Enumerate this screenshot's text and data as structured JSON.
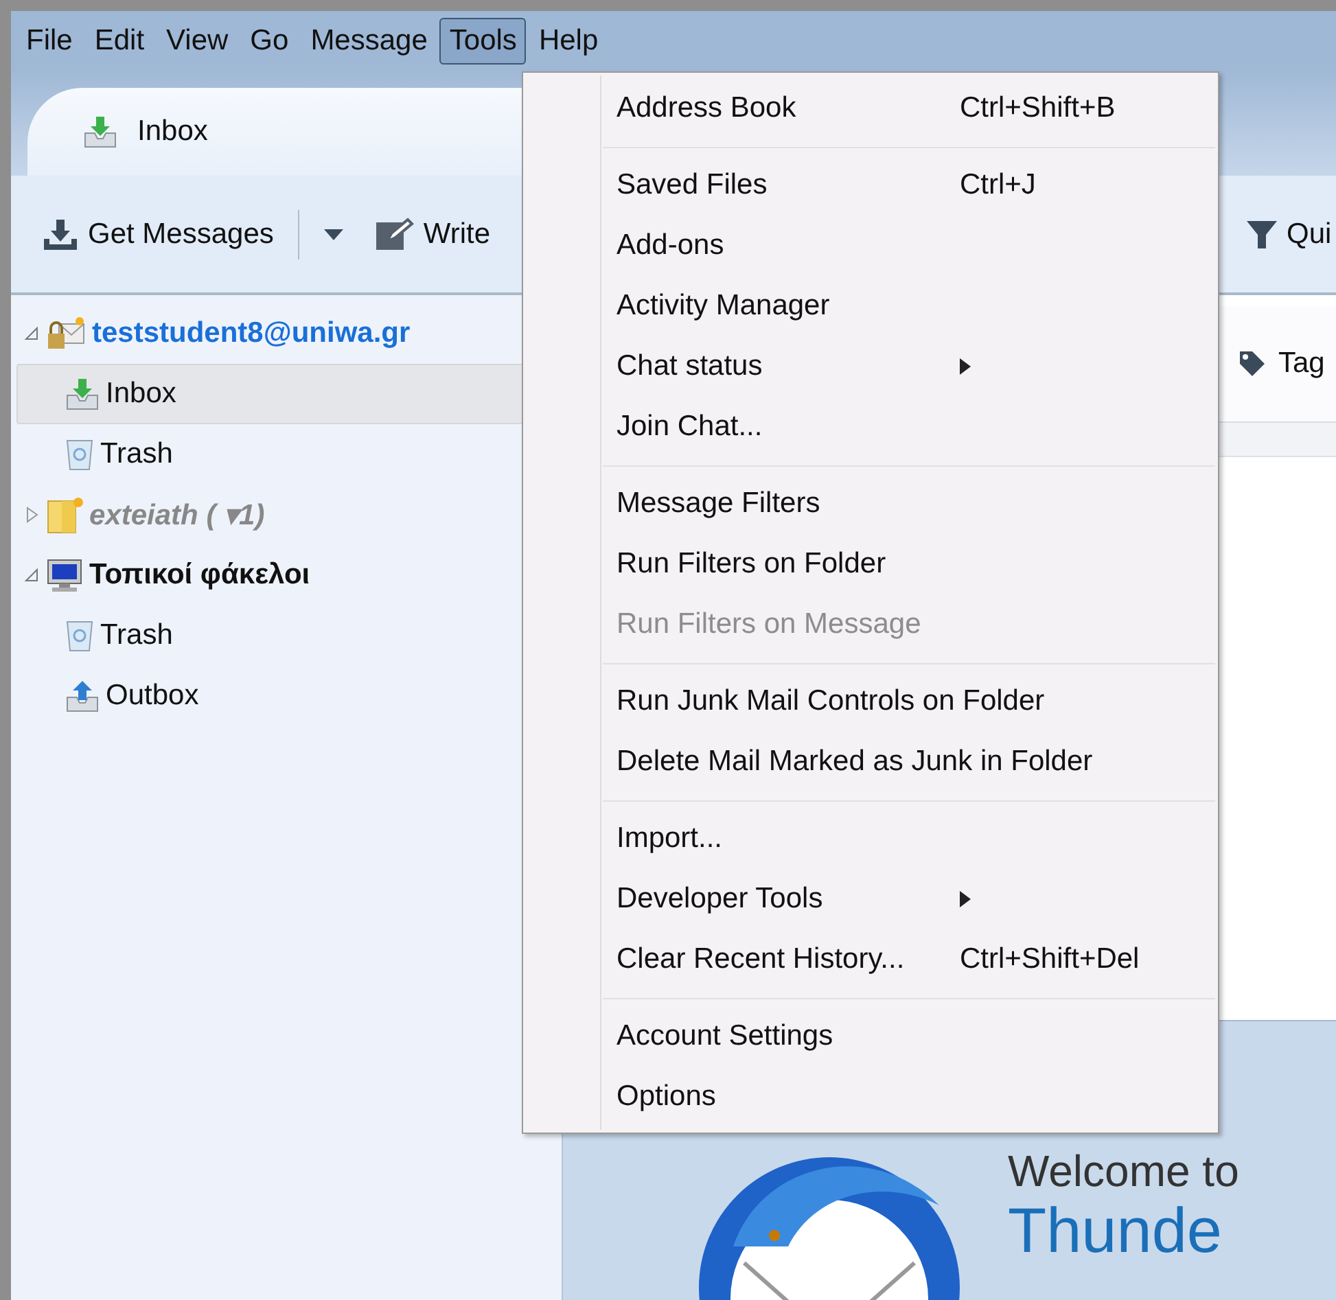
{
  "menu_bar": [
    {
      "label": "File",
      "selected": false
    },
    {
      "label": "Edit",
      "selected": false
    },
    {
      "label": "View",
      "selected": false
    },
    {
      "label": "Go",
      "selected": false
    },
    {
      "label": "Message",
      "selected": false
    },
    {
      "label": "Tools",
      "selected": true
    },
    {
      "label": "Help",
      "selected": false
    }
  ],
  "tabs": [
    {
      "label": "Inbox",
      "selected": true
    }
  ],
  "toolbar": [
    {
      "kind": "get",
      "label": "Get Messages"
    },
    {
      "kind": "write",
      "label": "Write"
    },
    {
      "kind": "filter",
      "label": "Qui"
    }
  ],
  "folder_tree": [
    {
      "label": "teststudent8@uniwa.gr",
      "kind": "account",
      "expanded": true,
      "selected": false,
      "disabled": false,
      "children": [
        {
          "label": "Inbox",
          "kind": "inbox",
          "selected": true
        },
        {
          "label": "Trash",
          "kind": "trash",
          "selected": false
        }
      ]
    },
    {
      "label": "exteiath ( ▾1)",
      "kind": "news",
      "expanded": false,
      "selected": false,
      "disabled": true
    },
    {
      "label": "Τοπικοί φάκελοι",
      "kind": "local",
      "expanded": true,
      "selected": false,
      "disabled": false,
      "children": [
        {
          "label": "Trash",
          "kind": "trash",
          "selected": false
        },
        {
          "label": "Outbox",
          "kind": "outbox",
          "selected": false
        }
      ]
    }
  ],
  "message_pane": {
    "tag_button": "Tag"
  },
  "welcome": {
    "heading": "Welcome to",
    "title": "Thunde"
  },
  "tools_menu": [
    {
      "kind": "item",
      "label": "Address Book",
      "shortcut": "Ctrl+Shift+B",
      "disabled": false,
      "submenu": false
    },
    {
      "kind": "separator"
    },
    {
      "kind": "item",
      "label": "Saved Files",
      "shortcut": "Ctrl+J",
      "disabled": false,
      "submenu": false
    },
    {
      "kind": "item",
      "label": "Add-ons",
      "disabled": false,
      "submenu": false
    },
    {
      "kind": "item",
      "label": "Activity Manager",
      "disabled": false,
      "submenu": false
    },
    {
      "kind": "item",
      "label": "Chat status",
      "disabled": false,
      "submenu": true
    },
    {
      "kind": "item",
      "label": "Join Chat...",
      "disabled": false,
      "submenu": false
    },
    {
      "kind": "separator"
    },
    {
      "kind": "item",
      "label": "Message Filters",
      "disabled": false,
      "submenu": false
    },
    {
      "kind": "item",
      "label": "Run Filters on Folder",
      "disabled": false,
      "submenu": false
    },
    {
      "kind": "item",
      "label": "Run Filters on Message",
      "disabled": true,
      "submenu": false
    },
    {
      "kind": "separator"
    },
    {
      "kind": "item",
      "label": "Run Junk Mail Controls on Folder",
      "disabled": false,
      "submenu": false
    },
    {
      "kind": "item",
      "label": "Delete Mail Marked as Junk in Folder",
      "disabled": false,
      "submenu": false
    },
    {
      "kind": "separator"
    },
    {
      "kind": "item",
      "label": "Import...",
      "disabled": false,
      "submenu": false
    },
    {
      "kind": "item",
      "label": "Developer Tools",
      "disabled": false,
      "submenu": true
    },
    {
      "kind": "item",
      "label": "Clear Recent History...",
      "shortcut": "Ctrl+Shift+Del",
      "disabled": false,
      "submenu": false
    },
    {
      "kind": "separator"
    },
    {
      "kind": "item",
      "label": "Account Settings",
      "disabled": false,
      "submenu": false
    },
    {
      "kind": "item",
      "label": "Options",
      "disabled": false,
      "submenu": false
    }
  ]
}
